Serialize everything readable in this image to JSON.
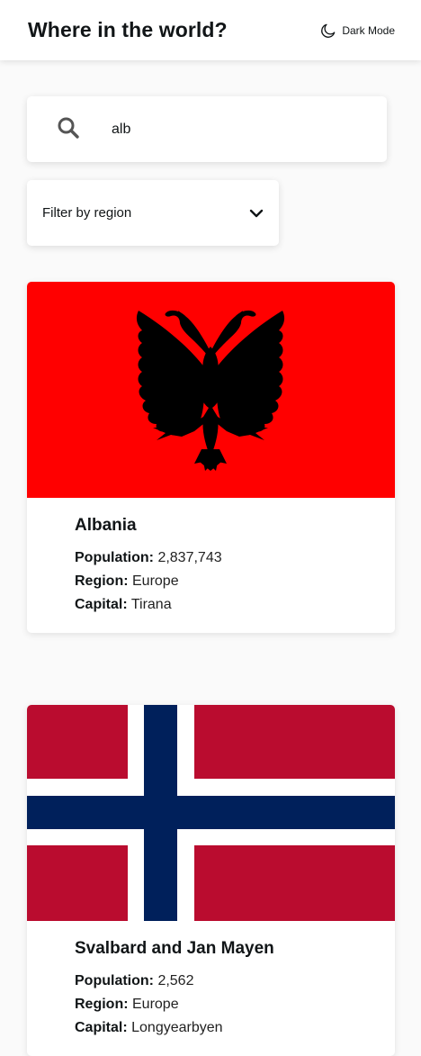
{
  "header": {
    "title": "Where in the world?",
    "theme_toggle_label": "Dark Mode",
    "theme_icon": "moon-icon"
  },
  "search": {
    "value": "alb",
    "icon": "search-icon"
  },
  "filter": {
    "label": "Filter by region",
    "icon": "chevron-down-icon"
  },
  "countries": [
    {
      "name": "Albania",
      "flag_icon": "flag-albania",
      "population_label": "Population:",
      "population": "2,837,743",
      "region_label": "Region:",
      "region": "Europe",
      "capital_label": "Capital:",
      "capital": "Tirana",
      "flag_colors": {
        "field": "#ff0000",
        "emblem": "#000000"
      }
    },
    {
      "name": "Svalbard and Jan Mayen",
      "flag_icon": "flag-svalbard-and-jan-mayen",
      "population_label": "Population:",
      "population": "2,562",
      "region_label": "Region:",
      "region": "Europe",
      "capital_label": "Capital:",
      "capital": "Longyearbyen",
      "flag_colors": {
        "field": "#ba0c2f",
        "border": "#ffffff",
        "cross": "#00205b"
      }
    }
  ]
}
